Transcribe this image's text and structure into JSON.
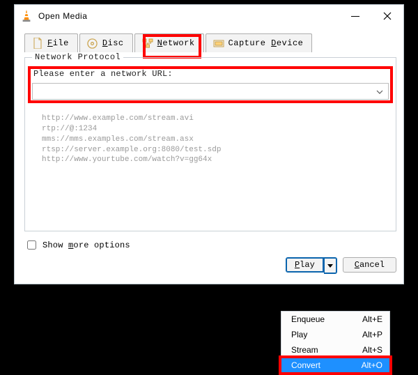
{
  "window": {
    "title": "Open Media"
  },
  "tabs": {
    "file": {
      "hotkey": "F",
      "suffix": "ile"
    },
    "disc": {
      "hotkey": "D",
      "suffix": "isc"
    },
    "network": {
      "hotkey": "N",
      "suffix": "etwork"
    },
    "capture": {
      "hotkey": "C",
      "prefix": "Capture ",
      "hotkey2": "D",
      "suffix": "evice"
    }
  },
  "panel": {
    "legend": "Network Protocol",
    "url_label": "Please enter a network URL:",
    "url_value": "",
    "examples": [
      "http://www.example.com/stream.avi",
      "rtp://@:1234",
      "mms://mms.examples.com/stream.asx",
      "rtsp://server.example.org:8080/test.sdp",
      "http://www.yourtube.com/watch?v=gg64x"
    ]
  },
  "show_more": {
    "pre": "Show ",
    "hk": "m",
    "post": "ore options"
  },
  "buttons": {
    "play": {
      "hk": "P",
      "suffix": "lay"
    },
    "cancel": {
      "hk": "C",
      "suffix": "ancel"
    }
  },
  "menu": {
    "items": [
      {
        "label": "Enqueue",
        "shortcut": "Alt+E"
      },
      {
        "label": "Play",
        "shortcut": "Alt+P"
      },
      {
        "label": "Stream",
        "shortcut": "Alt+S"
      },
      {
        "label": "Convert",
        "shortcut": "Alt+O",
        "selected": true
      }
    ]
  }
}
